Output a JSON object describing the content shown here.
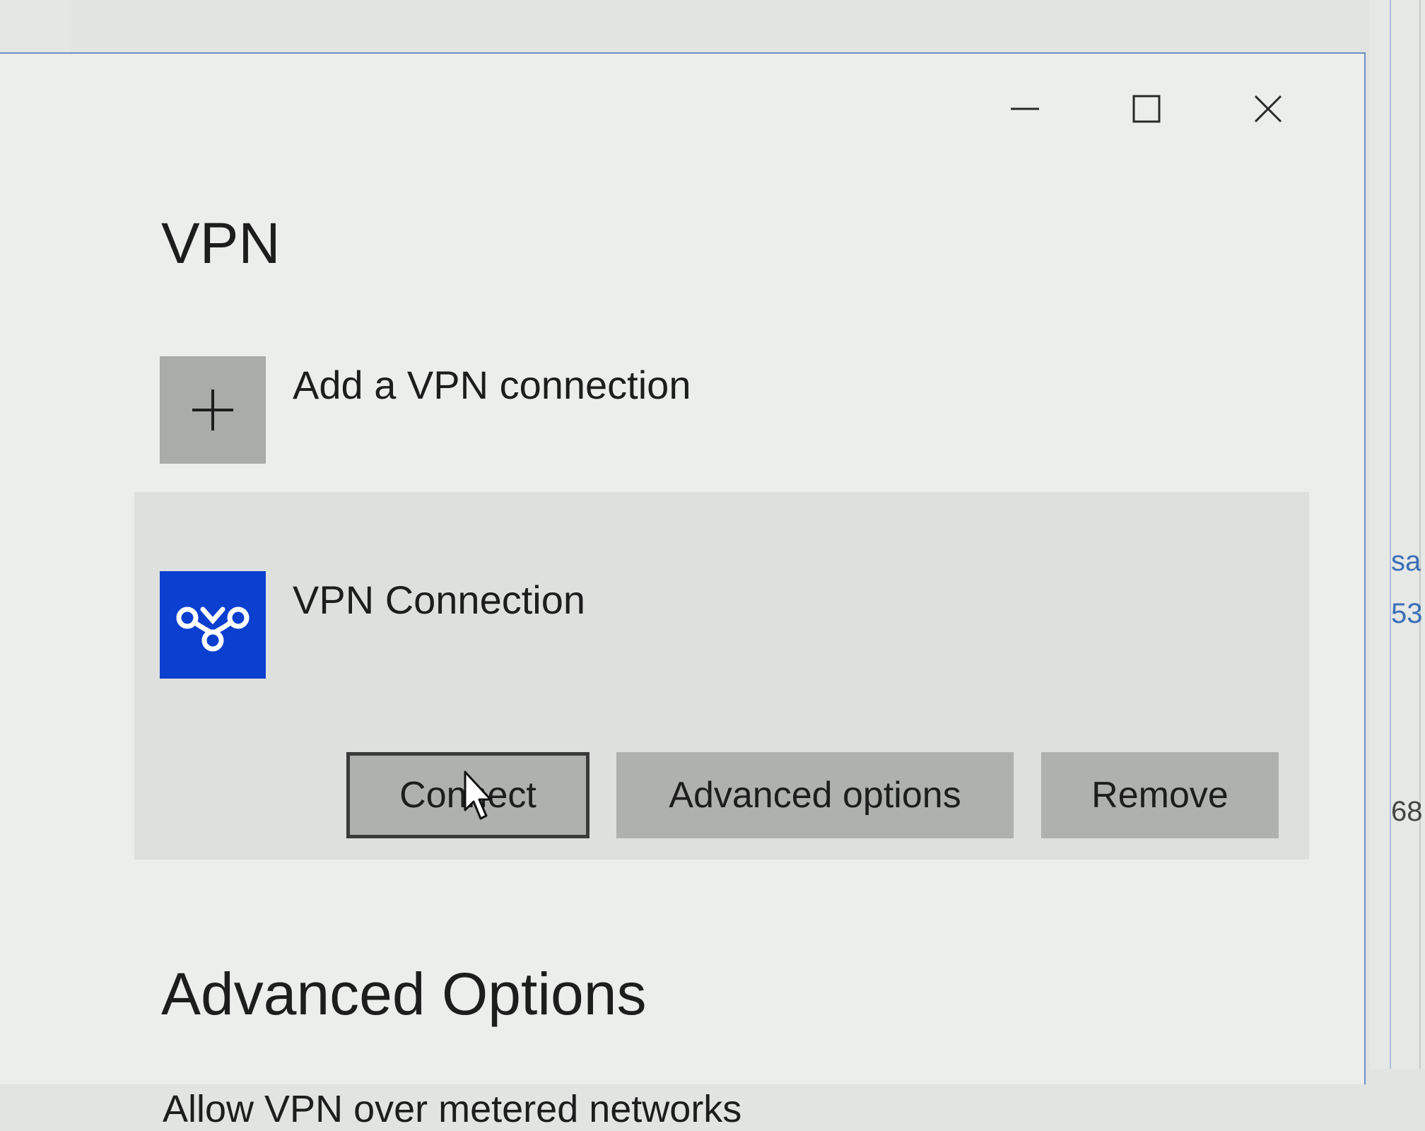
{
  "window": {
    "controls": {
      "minimize": "minimize",
      "maximize": "maximize",
      "close": "close"
    },
    "title": "VPN"
  },
  "add_connection": {
    "label": "Add a VPN connection",
    "icon": "plus-icon"
  },
  "vpn_connection": {
    "name": "VPN Connection",
    "icon": "vpn-connection-icon",
    "tile_color": "#0b3fcf",
    "buttons": {
      "connect": "Connect",
      "advanced_options": "Advanced options",
      "remove": "Remove"
    }
  },
  "advanced_options_section": {
    "title": "Advanced Options",
    "metered_label": "Allow VPN over metered networks"
  },
  "background_window": {
    "texts": [
      "sa",
      "53",
      "68"
    ]
  }
}
